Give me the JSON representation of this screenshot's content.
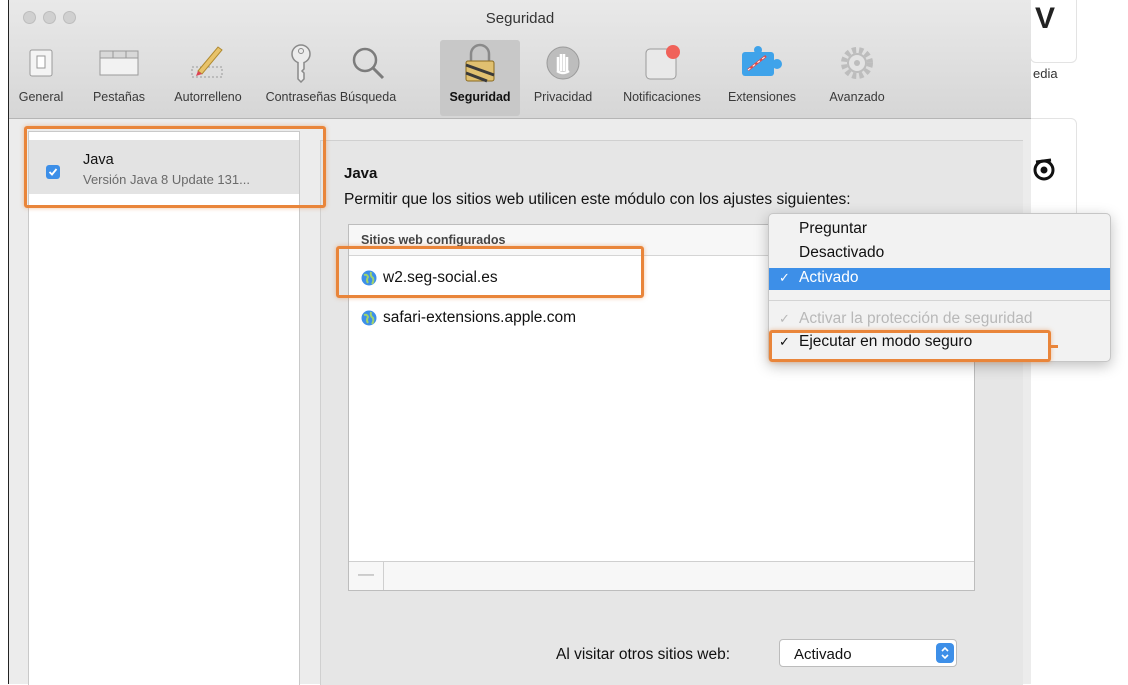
{
  "window": {
    "title": "Seguridad"
  },
  "toolbar": {
    "items": [
      {
        "label": "General",
        "icon": "switch-icon"
      },
      {
        "label": "Pestañas",
        "icon": "tabs-icon"
      },
      {
        "label": "Autorrelleno",
        "icon": "pencil-icon"
      },
      {
        "label": "Contraseñas",
        "icon": "key-icon"
      },
      {
        "label": "Búsqueda",
        "icon": "search-icon"
      },
      {
        "label": "Seguridad",
        "icon": "lock-icon",
        "selected": true
      },
      {
        "label": "Privacidad",
        "icon": "hand-icon"
      },
      {
        "label": "Notificaciones",
        "icon": "notification-icon"
      },
      {
        "label": "Extensiones",
        "icon": "puzzle-icon"
      },
      {
        "label": "Avanzado",
        "icon": "gear-icon"
      }
    ]
  },
  "plugins": {
    "items": [
      {
        "name": "Java",
        "version": "Versión Java 8 Update 131...",
        "enabled": true
      }
    ]
  },
  "settings": {
    "title": "Java",
    "description": "Permitir que los sitios web utilicen este módulo con los ajustes siguientes:",
    "table_header": "Sitios web configurados",
    "sites": [
      "w2.seg-social.es",
      "safari-extensions.apple.com"
    ],
    "remove_label": "—",
    "visit_label": "Al visitar otros sitios web:",
    "visit_value": "Activado"
  },
  "menu": {
    "items": [
      {
        "label": "Preguntar",
        "checked": false
      },
      {
        "label": "Desactivado",
        "checked": false
      },
      {
        "label": "Activado",
        "checked": true,
        "highlighted": true
      },
      {
        "label": "Activar la protección de seguridad",
        "checked": true,
        "disabled": true
      },
      {
        "label": "Ejecutar en modo seguro",
        "checked": true
      }
    ],
    "check_mark": "✓"
  },
  "background": {
    "partial_text": "edia",
    "partial_glyph": "V"
  },
  "colors": {
    "accent": "#3d8fe8",
    "highlight_box": "#e9853a"
  }
}
